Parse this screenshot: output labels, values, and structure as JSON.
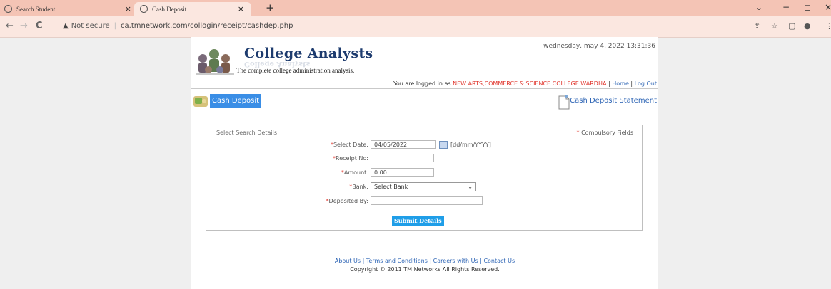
{
  "browser": {
    "tabs": [
      {
        "title": "Search Student",
        "close": "×"
      },
      {
        "title": "Cash Deposit",
        "close": "×"
      }
    ],
    "new_tab": "+",
    "window_controls": {
      "dropdown": "⌄",
      "minimize": "−",
      "maximize": "◻",
      "close": "×"
    },
    "nav": {
      "back": "←",
      "forward": "→",
      "reload": "C"
    },
    "address": {
      "security": "Not secure",
      "url": "ca.tmnetwork.com/collogin/receipt/cashdep.php"
    },
    "toolbar_icons": [
      "share-icon",
      "star-icon",
      "sidebar-icon",
      "profile-icon",
      "menu-icon"
    ]
  },
  "header": {
    "brand": "College Analysts",
    "tagline": "The complete college administration analysis.",
    "date": "wednesday, may 4, 2022 13:31:36",
    "login_prefix": "You are logged in as ",
    "college": "NEW ARTS,COMMERCE & SCIENCE COLLEGE WARDHA",
    "home": "Home",
    "logout": "Log Out",
    "sep": " | "
  },
  "section": {
    "title": "Cash Deposit",
    "statement_link": "Cash Deposit Statement"
  },
  "form": {
    "heading": "Select Search Details",
    "compulsory": "Compulsory Fields",
    "required_mark": "*",
    "date_label": "Select Date:",
    "date_value": "04/05/2022",
    "date_format": "[dd/mm/YYYY]",
    "receipt_label": "Receipt No:",
    "receipt_value": "",
    "amount_label": "Amount:",
    "amount_value": "0.00",
    "bank_label": "Bank:",
    "bank_value": "Select Bank",
    "deposited_label": "Deposited By:",
    "deposited_value": "",
    "submit": "Submit Details"
  },
  "footer": {
    "links": [
      "About Us",
      "Terms and Conditions",
      "Careers with Us",
      "Contact Us"
    ],
    "sep": " | ",
    "copyright": "Copyright © 2011 TM Networks All Rights Reserved."
  },
  "colors": {
    "tab_strip": "#f4c4b5",
    "accent": "#3a8ee6",
    "link": "#2e65b5",
    "required": "#e0352c"
  }
}
